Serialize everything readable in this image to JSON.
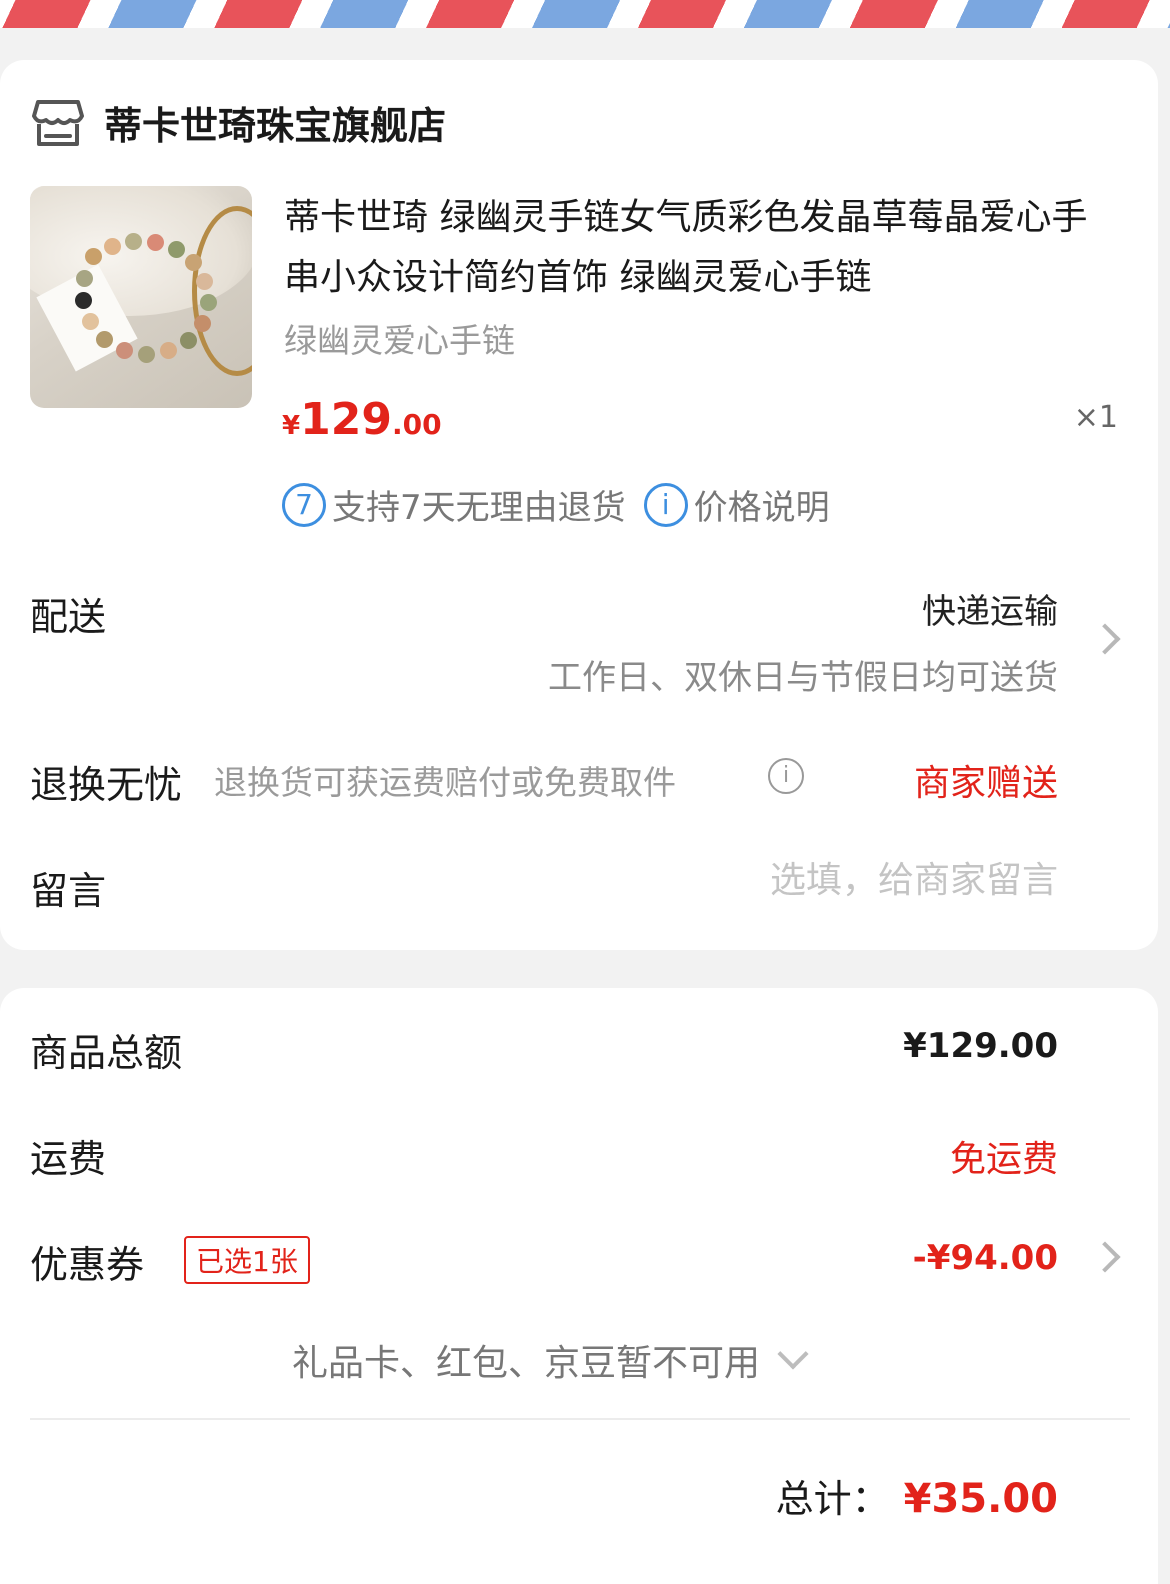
{
  "shop": {
    "name": "蒂卡世琦珠宝旗舰店",
    "icon": "store-icon"
  },
  "product": {
    "title": "蒂卡世琦 绿幽灵手链女气质彩色发晶草莓晶爱心手串小众设计简约首饰 绿幽灵爱心手链",
    "spec": "绿幽灵爱心手链",
    "price_symbol": "¥",
    "price_int": "129",
    "price_dec": ".00",
    "quantity": "×1",
    "services": [
      {
        "icon": "seven-day-return-icon",
        "badge": "7",
        "label": "支持7天无理由退货"
      },
      {
        "icon": "info-icon",
        "badge": "i",
        "label": "价格说明"
      }
    ]
  },
  "delivery": {
    "label": "配送",
    "value": "快递运输",
    "note": "工作日、双休日与节假日均可送货"
  },
  "return_worry_free": {
    "label": "退换无忧",
    "desc": "退换货可获运费赔付或免费取件",
    "info": "i",
    "value": "商家赠送"
  },
  "message": {
    "label": "留言",
    "placeholder": "选填，给商家留言",
    "value": ""
  },
  "summary": {
    "goods_total_label": "商品总额",
    "goods_total_value": "¥129.00",
    "shipping_label": "运费",
    "shipping_value": "免运费",
    "coupon_label": "优惠券",
    "coupon_badge": "已选1张",
    "coupon_value": "-¥94.00",
    "giftcard_note": "礼品卡、红包、京豆暂不可用",
    "total_label": "总计：",
    "total_value": "¥35.00"
  },
  "colors": {
    "accent_red": "#e2231a",
    "service_blue": "#3d8fe0",
    "stripe_red": "#e8535a",
    "stripe_blue": "#7ba7e0"
  }
}
